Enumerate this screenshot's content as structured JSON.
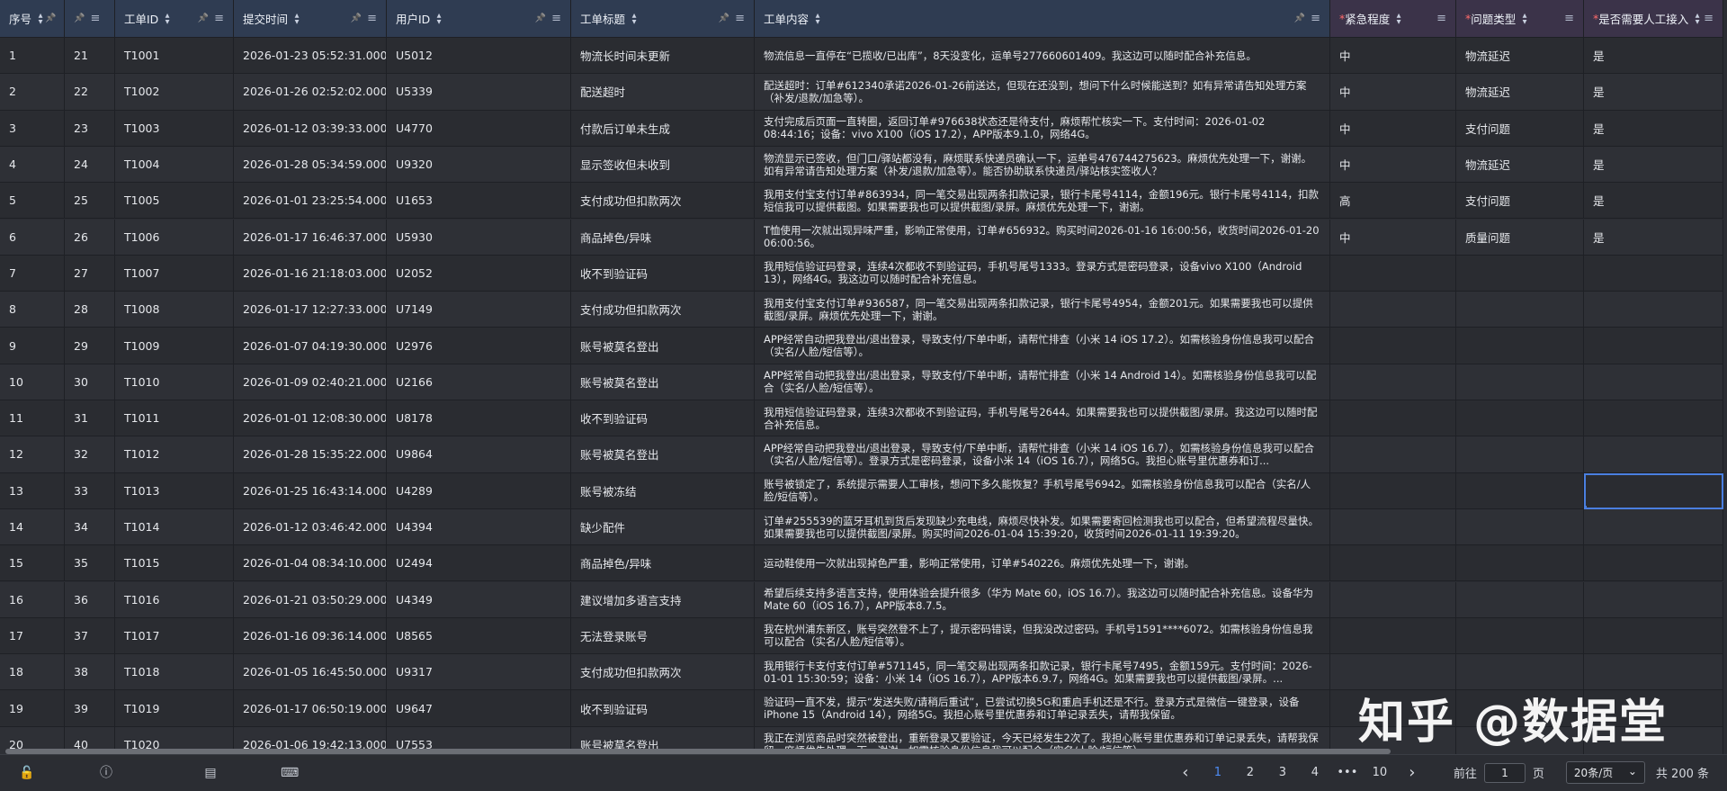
{
  "columns": [
    {
      "label": "序号",
      "required": false
    },
    {
      "label": "",
      "required": false
    },
    {
      "label": "工单ID",
      "required": false
    },
    {
      "label": "提交时间",
      "required": false
    },
    {
      "label": "用户ID",
      "required": false
    },
    {
      "label": "工单标题",
      "required": false
    },
    {
      "label": "工单内容",
      "required": false
    },
    {
      "label": "紧急程度",
      "required": true
    },
    {
      "label": "问题类型",
      "required": true
    },
    {
      "label": "是否需要人工接入",
      "required": true
    }
  ],
  "rows": [
    [
      "1",
      "21",
      "T1001",
      "2026-01-23 05:52:31.000",
      "U5012",
      "物流长时间未更新",
      "物流信息一直停在“已揽收/已出库”，8天没变化，运单号277660601409。我这边可以随时配合补充信息。",
      "中",
      "物流延迟",
      "是"
    ],
    [
      "2",
      "22",
      "T1002",
      "2026-01-26 02:52:02.000",
      "U5339",
      "配送超时",
      "配送超时：订单#612340承诺2026-01-26前送达，但现在还没到，想问下什么时候能送到？如有异常请告知处理方案（补发/退款/加急等）。",
      "中",
      "物流延迟",
      "是"
    ],
    [
      "3",
      "23",
      "T1003",
      "2026-01-12 03:39:33.000",
      "U4770",
      "付款后订单未生成",
      "支付完成后页面一直转圈，返回订单#976638状态还是待支付，麻烦帮忙核实一下。支付时间：2026-01-02 08:44:16；设备：vivo X100（iOS 17.2），APP版本9.1.0，网络4G。",
      "中",
      "支付问题",
      "是"
    ],
    [
      "4",
      "24",
      "T1004",
      "2026-01-28 05:34:59.000",
      "U9320",
      "显示签收但未收到",
      "物流显示已签收，但门口/驿站都没有，麻烦联系快递员确认一下，运单号476744275623。麻烦优先处理一下，谢谢。如有异常请告知处理方案（补发/退款/加急等）。能否协助联系快递员/驿站核实签收人？",
      "中",
      "物流延迟",
      "是"
    ],
    [
      "5",
      "25",
      "T1005",
      "2026-01-01 23:25:54.000",
      "U1653",
      "支付成功但扣款两次",
      "我用支付宝支付订单#863934，同一笔交易出现两条扣款记录，银行卡尾号4114，金额196元。银行卡尾号4114，扣款短信我可以提供截图。如果需要我也可以提供截图/录屏。麻烦优先处理一下，谢谢。",
      "高",
      "支付问题",
      "是"
    ],
    [
      "6",
      "26",
      "T1006",
      "2026-01-17 16:46:37.000",
      "U5930",
      "商品掉色/异味",
      "T恤使用一次就出现异味严重，影响正常使用，订单#656932。购买时间2026-01-16 16:00:56，收货时间2026-01-20 06:00:56。",
      "中",
      "质量问题",
      "是"
    ],
    [
      "7",
      "27",
      "T1007",
      "2026-01-16 21:18:03.000",
      "U2052",
      "收不到验证码",
      "我用短信验证码登录，连续4次都收不到验证码，手机号尾号1333。登录方式是密码登录，设备vivo X100（Android 13），网络4G。我这边可以随时配合补充信息。",
      "",
      "",
      ""
    ],
    [
      "8",
      "28",
      "T1008",
      "2026-01-17 12:27:33.000",
      "U7149",
      "支付成功但扣款两次",
      "我用支付宝支付订单#936587，同一笔交易出现两条扣款记录，银行卡尾号4954，金额201元。如果需要我也可以提供截图/录屏。麻烦优先处理一下，谢谢。",
      "",
      "",
      ""
    ],
    [
      "9",
      "29",
      "T1009",
      "2026-01-07 04:19:30.000",
      "U2976",
      "账号被莫名登出",
      "APP经常自动把我登出/退出登录，导致支付/下单中断，请帮忙排查（小米 14 iOS 17.2）。如需核验身份信息我可以配合（实名/人脸/短信等）。",
      "",
      "",
      ""
    ],
    [
      "10",
      "30",
      "T1010",
      "2026-01-09 02:40:21.000",
      "U2166",
      "账号被莫名登出",
      "APP经常自动把我登出/退出登录，导致支付/下单中断，请帮忙排查（小米 14 Android 14）。如需核验身份信息我可以配合（实名/人脸/短信等）。",
      "",
      "",
      ""
    ],
    [
      "11",
      "31",
      "T1011",
      "2026-01-01 12:08:30.000",
      "U8178",
      "收不到验证码",
      "我用短信验证码登录，连续3次都收不到验证码，手机号尾号2644。如果需要我也可以提供截图/录屏。我这边可以随时配合补充信息。",
      "",
      "",
      ""
    ],
    [
      "12",
      "32",
      "T1012",
      "2026-01-28 15:35:22.000",
      "U9864",
      "账号被莫名登出",
      "APP经常自动把我登出/退出登录，导致支付/下单中断，请帮忙排查（小米 14 iOS 16.7）。如需核验身份信息我可以配合（实名/人脸/短信等）。登录方式是密码登录，设备小米 14（iOS 16.7），网络5G。我担心账号里优惠券和订...",
      "",
      "",
      ""
    ],
    [
      "13",
      "33",
      "T1013",
      "2026-01-25 16:43:14.000",
      "U4289",
      "账号被冻结",
      "账号被锁定了，系统提示需要人工审核，想问下多久能恢复？手机号尾号6942。如需核验身份信息我可以配合（实名/人脸/短信等）。",
      "",
      "",
      ""
    ],
    [
      "14",
      "34",
      "T1014",
      "2026-01-12 03:46:42.000",
      "U4394",
      "缺少配件",
      "订单#255539的蓝牙耳机到货后发现缺少充电线，麻烦尽快补发。如果需要寄回检测我也可以配合，但希望流程尽量快。如果需要我也可以提供截图/录屏。购买时间2026-01-04 15:39:20，收货时间2026-01-11 19:39:20。",
      "",
      "",
      ""
    ],
    [
      "15",
      "35",
      "T1015",
      "2026-01-04 08:34:10.000",
      "U2494",
      "商品掉色/异味",
      "运动鞋使用一次就出现掉色严重，影响正常使用，订单#540226。麻烦优先处理一下，谢谢。",
      "",
      "",
      ""
    ],
    [
      "16",
      "36",
      "T1016",
      "2026-01-21 03:50:29.000",
      "U4349",
      "建议增加多语言支持",
      "希望后续支持多语言支持，使用体验会提升很多（华为 Mate 60，iOS 16.7）。我这边可以随时配合补充信息。设备华为 Mate 60（iOS 16.7），APP版本8.7.5。",
      "",
      "",
      ""
    ],
    [
      "17",
      "37",
      "T1017",
      "2026-01-16 09:36:14.000",
      "U8565",
      "无法登录账号",
      "我在杭州浦东新区，账号突然登不上了，提示密码错误，但我没改过密码。手机号1591****6072。如需核验身份信息我可以配合（实名/人脸/短信等）。",
      "",
      "",
      ""
    ],
    [
      "18",
      "38",
      "T1018",
      "2026-01-05 16:45:50.000",
      "U9317",
      "支付成功但扣款两次",
      "我用银行卡支付支付订单#571145，同一笔交易出现两条扣款记录，银行卡尾号7495，金额159元。支付时间：2026-01-01 15:30:59；设备：小米 14（iOS 16.7），APP版本6.9.7，网络4G。如果需要我也可以提供截图/录屏。...",
      "",
      "",
      ""
    ],
    [
      "19",
      "39",
      "T1019",
      "2026-01-17 06:50:19.000",
      "U9647",
      "收不到验证码",
      "验证码一直不发，提示“发送失败/请稍后重试”，已尝试切换5G和重启手机还是不行。登录方式是微信一键登录，设备iPhone 15（Android 14），网络5G。我担心账号里优惠券和订单记录丢失，请帮我保留。",
      "",
      "",
      ""
    ],
    [
      "20",
      "40",
      "T1020",
      "2026-01-06 19:42:13.000",
      "U7553",
      "账号被莫名登出",
      "我正在浏览商品时突然被登出，重新登录又要验证，今天已经发生2次了。我担心账号里优惠券和订单记录丢失，请帮我保留。麻烦优先处理一下，谢谢。如需核验身份信息我可以配合（实名/人脸/短信等）。",
      "",
      "",
      ""
    ]
  ],
  "pagination": {
    "prev": "‹",
    "pages": [
      "1",
      "2",
      "3",
      "4",
      "•••",
      "10"
    ],
    "next": "›",
    "goto_label": "前往",
    "goto_value": "1",
    "page_label": "页",
    "page_size": "20条/页",
    "total": "共 200 条"
  },
  "watermark": "知乎 @数据堂",
  "colors": {
    "header_bg": "#2f3c52",
    "header_required_bg": "#3b3349",
    "required_mark": "#ff6b6b",
    "accent": "#4d8cf5",
    "selection": "#4a7fe0"
  }
}
